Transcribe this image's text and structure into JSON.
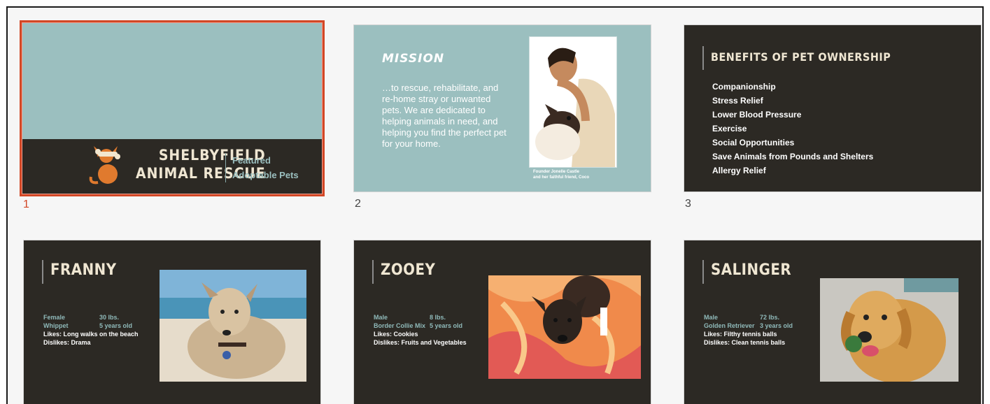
{
  "slides": [
    {
      "number": "1",
      "title_line1": "SHELBYFIELD",
      "title_line2": "ANIMAL RESCUE",
      "subtitle_line1": "Featured",
      "subtitle_line2": "Adoptable Pets",
      "logo_icon": "dog-logo-icon"
    },
    {
      "number": "2",
      "title": "MISSION",
      "body": "…to rescue, rehabilitate, and re-home stray or unwanted pets. We are dedicated to helping animals in need, and helping you find the perfect pet for your home.",
      "caption_line1": "Founder Jonelle Castle",
      "caption_line2": "and her faithful friend, Coco"
    },
    {
      "number": "3",
      "title": "BENEFITS OF PET OWNERSHIP",
      "items": [
        "Companionship",
        "Stress Relief",
        "Lower Blood Pressure",
        "Exercise",
        "Social Opportunities",
        "Save Animals from Pounds and Shelters",
        "Allergy Relief"
      ]
    },
    {
      "title": "FRANNY",
      "sex": "Female",
      "weight": "30 lbs.",
      "breed": "Whippet",
      "age": "5 years old",
      "likes_label": "Likes:",
      "likes": "Long walks on the beach",
      "dislikes_label": "Dislikes:",
      "dislikes": "Drama"
    },
    {
      "title": "ZOOEY",
      "sex": "Male",
      "weight": "8 lbs.",
      "breed": "Border Collie Mix",
      "age": "5 years old",
      "likes_label": "Likes:",
      "likes": "Cookies",
      "dislikes_label": "Dislikes:",
      "dislikes": "Fruits and Vegetables"
    },
    {
      "title": "SALINGER",
      "sex": "Male",
      "weight": "72 lbs.",
      "breed": "Golden Retriever",
      "age": "3 years old",
      "likes_label": "Likes:",
      "likes": "Filthy tennis balls",
      "dislikes_label": "Dislikes:",
      "dislikes": "Clean tennis balls"
    }
  ],
  "colors": {
    "selection": "#d24726",
    "teal": "#9bbfbf",
    "dark": "#2c2924"
  }
}
